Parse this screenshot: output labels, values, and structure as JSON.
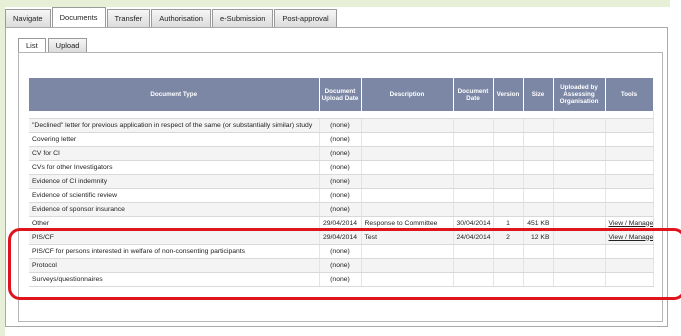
{
  "main_tabs": [
    "Navigate",
    "Documents",
    "Transfer",
    "Authorisation",
    "e-Submission",
    "Post-approval"
  ],
  "sub_tabs": [
    "List",
    "Upload"
  ],
  "columns": {
    "type": "Document Type",
    "upload_date": "Document Upload Date",
    "description": "Description",
    "doc_date": "Document Date",
    "version": "Version",
    "size": "Size",
    "uploaded_by": "Uploaded by Assessing Organisation",
    "tools": "Tools"
  },
  "rows": [
    {
      "type": "\"Declined\" letter for previous application in respect of the same (or substantially similar) study",
      "upload_date": "(none)",
      "description": "",
      "doc_date": "",
      "version": "",
      "size": "",
      "uploaded_by": "",
      "tools": ""
    },
    {
      "type": "Covering letter",
      "upload_date": "(none)",
      "description": "",
      "doc_date": "",
      "version": "",
      "size": "",
      "uploaded_by": "",
      "tools": ""
    },
    {
      "type": "CV for CI",
      "upload_date": "(none)",
      "description": "",
      "doc_date": "",
      "version": "",
      "size": "",
      "uploaded_by": "",
      "tools": ""
    },
    {
      "type": "CVs for other Investigators",
      "upload_date": "(none)",
      "description": "",
      "doc_date": "",
      "version": "",
      "size": "",
      "uploaded_by": "",
      "tools": ""
    },
    {
      "type": "Evidence of CI indemnity",
      "upload_date": "(none)",
      "description": "",
      "doc_date": "",
      "version": "",
      "size": "",
      "uploaded_by": "",
      "tools": ""
    },
    {
      "type": "Evidence of scientific review",
      "upload_date": "(none)",
      "description": "",
      "doc_date": "",
      "version": "",
      "size": "",
      "uploaded_by": "",
      "tools": ""
    },
    {
      "type": "Evidence of sponsor insurance",
      "upload_date": "(none)",
      "description": "",
      "doc_date": "",
      "version": "",
      "size": "",
      "uploaded_by": "",
      "tools": ""
    },
    {
      "type": "Other",
      "upload_date": "29/04/2014",
      "description": "Response to Committee",
      "doc_date": "30/04/2014",
      "version": "1",
      "size": "451 KB",
      "uploaded_by": "",
      "tools": "View / Manage"
    },
    {
      "type": "PIS/CF",
      "upload_date": "29/04/2014",
      "description": "Test",
      "doc_date": "24/04/2014",
      "version": "2",
      "size": "12 KB",
      "uploaded_by": "",
      "tools": "View / Manage"
    },
    {
      "type": "PIS/CF for persons interested in welfare of non-consenting participants",
      "upload_date": "(none)",
      "description": "",
      "doc_date": "",
      "version": "",
      "size": "",
      "uploaded_by": "",
      "tools": ""
    },
    {
      "type": "Protocol",
      "upload_date": "(none)",
      "description": "",
      "doc_date": "",
      "version": "",
      "size": "",
      "uploaded_by": "",
      "tools": ""
    },
    {
      "type": "Surveys/questionnaires",
      "upload_date": "(none)",
      "description": "",
      "doc_date": "",
      "version": "",
      "size": "",
      "uploaded_by": "",
      "tools": ""
    }
  ],
  "colors": {
    "header_bg": "#7b87a4",
    "highlight": "#e0141c",
    "band": "#e7efd6"
  }
}
